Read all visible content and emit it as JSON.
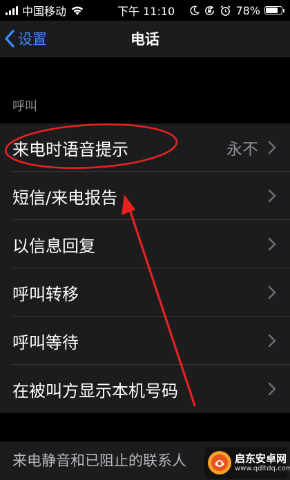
{
  "status_bar": {
    "carrier": "中国移动",
    "time": "下午 11:10",
    "battery_percent_label": "78%",
    "battery_level": 0.78,
    "icons": [
      "signal-bars-icon",
      "wifi-icon",
      "moon-icon",
      "orientation-lock-icon",
      "alarm-icon",
      "battery-icon"
    ]
  },
  "nav": {
    "back_label": "设置",
    "title": "电话"
  },
  "calls_section": {
    "header": "呼叫",
    "items": [
      {
        "label": "来电时语音提示",
        "value": "永不"
      },
      {
        "label": "短信/来电报告"
      },
      {
        "label": "以信息回复"
      },
      {
        "label": "呼叫转移"
      },
      {
        "label": "呼叫等待"
      },
      {
        "label": "在被叫方显示本机号码"
      }
    ]
  },
  "blocked_section": {
    "label": "来电静音和已阻止的联系人"
  },
  "watermark": {
    "title": "启东安卓网",
    "url": "www.qdltdq.com"
  },
  "colors": {
    "background": "#000000",
    "cell_background": "#1c1c1e",
    "accent_blue": "#3e8bf7",
    "secondary_text": "#8d8d92",
    "annotation_red": "#e8221f"
  }
}
